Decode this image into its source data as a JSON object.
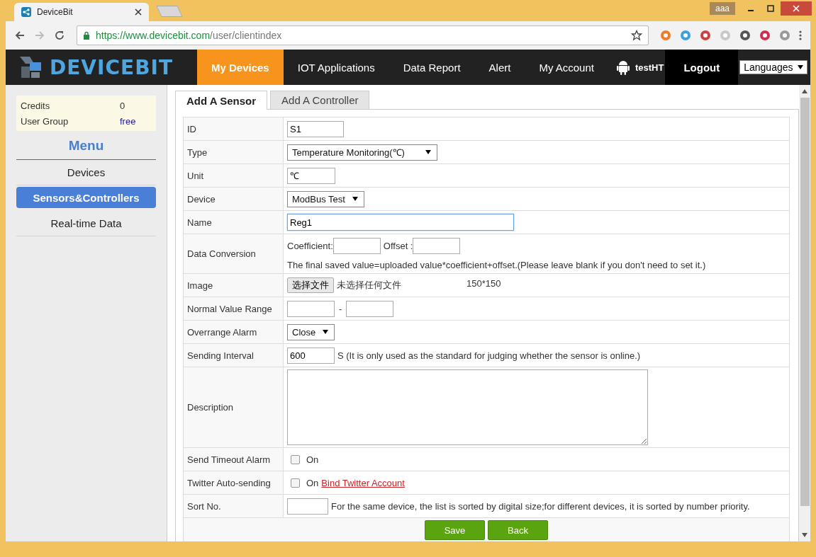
{
  "browser": {
    "user_badge": "aaa",
    "tab_title": "DeviceBit",
    "url_host": "https://www.devicebit.com",
    "url_path": "/user/clientindex"
  },
  "nav": {
    "logo": "DEVICEBIT",
    "items": [
      {
        "label": "My Devices",
        "selected": true
      },
      {
        "label": "IOT Applications",
        "selected": false
      },
      {
        "label": "Data Report",
        "selected": false
      },
      {
        "label": "Alert",
        "selected": false
      },
      {
        "label": "My Account",
        "selected": false
      }
    ],
    "user": "testHT",
    "logout": "Logout",
    "languages": "Languages"
  },
  "sidebar": {
    "info": [
      {
        "label": "Credits",
        "value": "0",
        "kind": "plain"
      },
      {
        "label": "User Group",
        "value": "free",
        "kind": "link"
      }
    ],
    "menu_title": "Menu",
    "items": [
      {
        "label": "Devices",
        "selected": false
      },
      {
        "label": "Sensors&Controllers",
        "selected": true
      },
      {
        "label": "Real-time Data",
        "selected": false
      }
    ]
  },
  "tabs": [
    {
      "label": "Add A Sensor",
      "selected": true
    },
    {
      "label": "Add A Controller",
      "selected": false
    }
  ],
  "form": [
    {
      "label": "ID",
      "kind": "text",
      "value": "S1",
      "focused": false
    },
    {
      "label": "Type",
      "kind": "select",
      "value": "Temperature Monitoring(℃)"
    },
    {
      "label": "Unit",
      "kind": "text",
      "value": "℃",
      "focused": false
    },
    {
      "label": "Device",
      "kind": "select",
      "value": "ModBus Test"
    },
    {
      "label": "Name",
      "kind": "long-text",
      "value": "Reg1",
      "focused": true
    },
    {
      "label": "Data Conversion",
      "kind": "conversion",
      "coefficient_label": "Coefficient:",
      "offset_label": "Offset :",
      "note": "The final saved value=uploaded value*coefficient+offset.(Please leave blank if you don't need to set it.)"
    },
    {
      "label": "Image",
      "kind": "file",
      "button": "选择文件",
      "status": "未选择任何文件",
      "hint": "150*150"
    },
    {
      "label": "Normal Value Range",
      "kind": "range",
      "separator": "-"
    },
    {
      "label": "Overrange Alarm",
      "kind": "select",
      "value": "Close"
    },
    {
      "label": "Sending Interval",
      "kind": "interval",
      "value": "600",
      "note": "S (It is only used as the standard for judging whether the sensor is online.)"
    },
    {
      "label": "Description",
      "kind": "textarea"
    },
    {
      "label": "Send Timeout Alarm",
      "kind": "checkbox",
      "checked": false,
      "option": "On"
    },
    {
      "label": "Twitter Auto-sending",
      "kind": "checkbox",
      "checked": false,
      "option": "On",
      "link": "Bind Twitter Account"
    },
    {
      "label": "Sort No.",
      "kind": "sort",
      "note": "For the same device, the list is sorted by digital size;for different devices, it is sorted by number priority."
    }
  ],
  "buttons": [
    {
      "label": "Save"
    },
    {
      "label": "Back"
    }
  ]
}
